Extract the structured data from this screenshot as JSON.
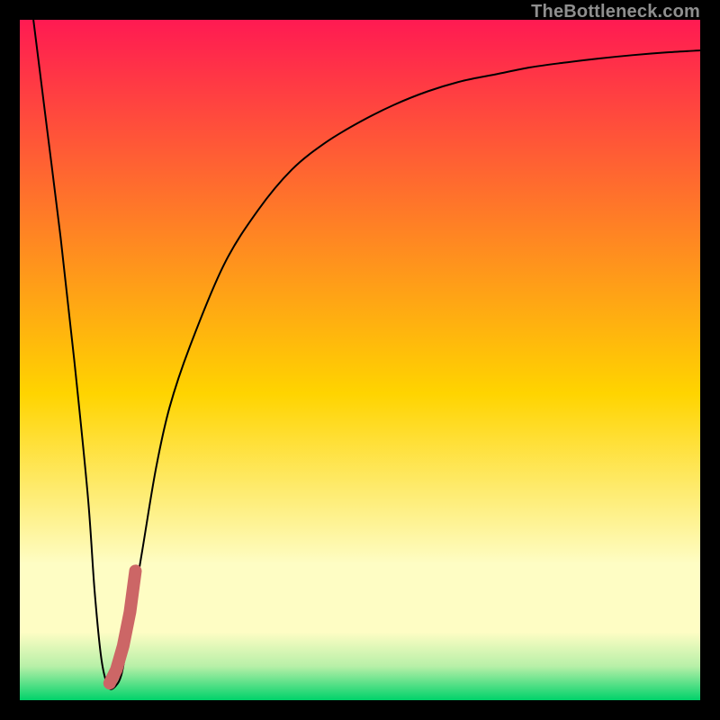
{
  "watermark": "TheBottleneck.com",
  "chart_data": {
    "type": "line",
    "title": "",
    "xlabel": "",
    "ylabel": "",
    "xlim": [
      0,
      100
    ],
    "ylim": [
      0,
      100
    ],
    "grid": false,
    "axes": false,
    "background_gradient": {
      "top": "#ff1a52",
      "mid": "#ffd400",
      "cream_band_top": "#fefdc4",
      "cream_band_bottom": "#fefdc4",
      "green_top": "#b8f0a8",
      "bottom": "#00d26a"
    },
    "series": [
      {
        "name": "bottleneck-curve",
        "stroke": "#000000",
        "stroke_width": 2,
        "x": [
          2,
          4,
          6,
          8,
          10,
          11,
          12,
          13,
          14,
          15,
          16,
          18,
          20,
          22,
          25,
          30,
          35,
          40,
          45,
          50,
          55,
          60,
          65,
          70,
          75,
          80,
          85,
          90,
          95,
          100
        ],
        "y": [
          100,
          84,
          68,
          50,
          30,
          16,
          6,
          2,
          2,
          4,
          10,
          22,
          34,
          43,
          52,
          64,
          72,
          78,
          82,
          85,
          87.5,
          89.5,
          91,
          92,
          93,
          93.7,
          94.3,
          94.8,
          95.2,
          95.5
        ]
      },
      {
        "name": "highlight-segment",
        "stroke": "#cc6666",
        "stroke_width": 14,
        "linecap": "round",
        "x": [
          13.2,
          14.2,
          15.2,
          16.2,
          17.0
        ],
        "y": [
          2.5,
          4.5,
          8,
          13,
          19
        ]
      }
    ]
  }
}
